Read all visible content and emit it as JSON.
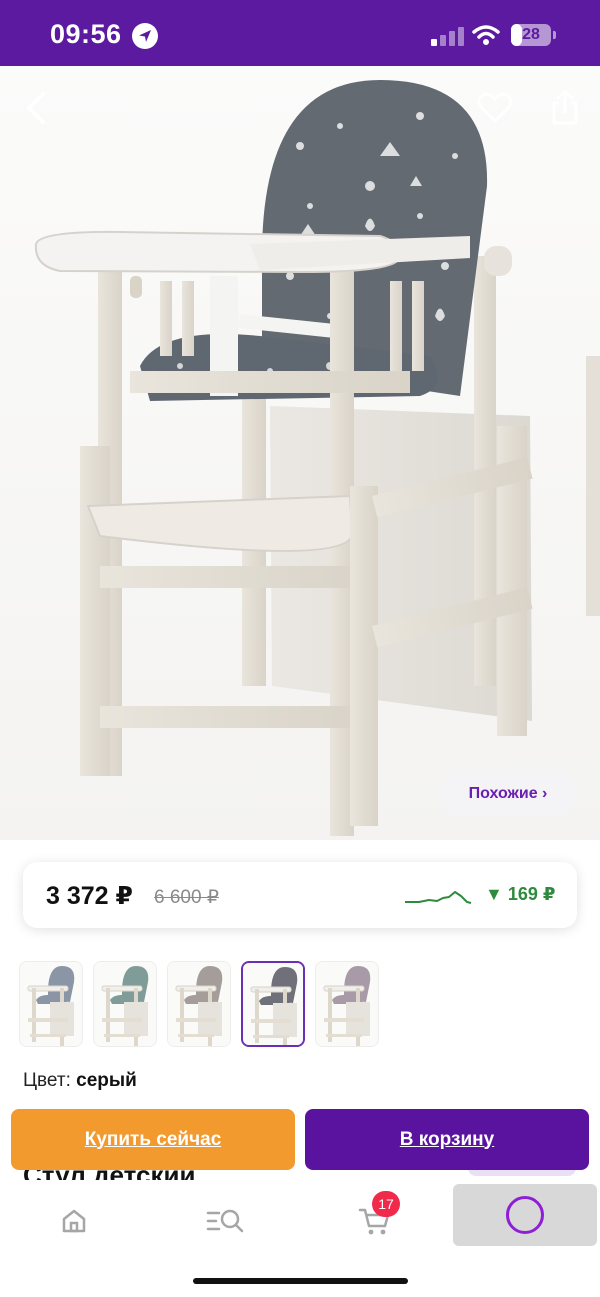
{
  "status_bar": {
    "time": "09:56",
    "battery": "28",
    "battery_level": 0.28,
    "location_icon": "location-arrow-icon",
    "background": "#5b1aa0"
  },
  "product": {
    "similar_label": "Похожие ›",
    "title_peek": "Стул детский",
    "price": {
      "current": "3 372 ₽",
      "old": "6 600 ₽",
      "drop": "▼ 169 ₽",
      "drop_color": "#2e8b3e"
    },
    "color_label": "Цвет:",
    "color_value": "серый",
    "swatch_colors": [
      "#8a96a6",
      "#7f9c98",
      "#a59d99",
      "#6f7079",
      "#a99aa8"
    ],
    "selected_swatch": 3
  },
  "actions": {
    "buy_now": "Купить сейчас",
    "add_to_cart": "В корзину",
    "buy_color": "#f29a2e",
    "cart_color": "#5a139e"
  },
  "tabbar": {
    "cart_badge": "17",
    "icons": [
      "home-icon",
      "catalog-search-icon",
      "cart-icon",
      "profile-icon"
    ],
    "accent": "#8f1fd6"
  }
}
